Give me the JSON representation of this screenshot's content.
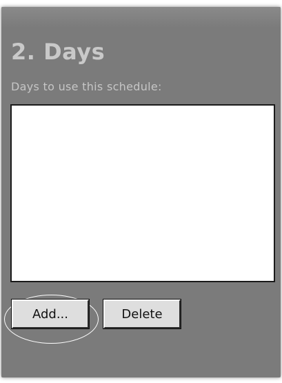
{
  "section": {
    "title": "2. Days",
    "subtitle": "Days to use this schedule:"
  },
  "days_list": {
    "items": []
  },
  "buttons": {
    "add_label": "Add...",
    "delete_label": "Delete"
  },
  "colors": {
    "panel_background": "#7b7b7b",
    "title_text": "#c9c9c9",
    "list_background": "#ffffff",
    "button_face": "#dedede",
    "highlight_ring": "#ffffff"
  }
}
